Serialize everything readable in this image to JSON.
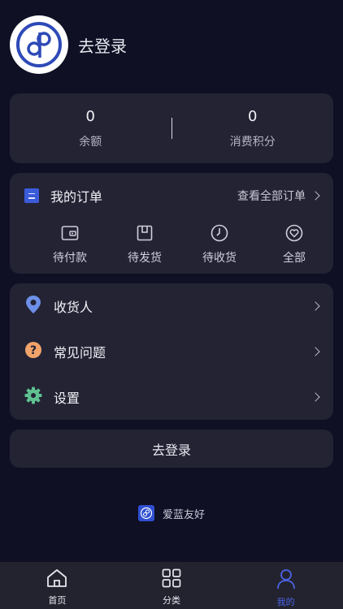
{
  "header": {
    "login_text": "去登录"
  },
  "stats": [
    {
      "value": "0",
      "label": "余额"
    },
    {
      "value": "0",
      "label": "消费积分"
    }
  ],
  "orders": {
    "title": "我的订单",
    "view_all": "查看全部订单",
    "items": [
      {
        "label": "待付款",
        "icon": "wallet-icon"
      },
      {
        "label": "待发货",
        "icon": "package-icon"
      },
      {
        "label": "待收货",
        "icon": "clock-icon"
      },
      {
        "label": "全部",
        "icon": "heart-icon"
      }
    ]
  },
  "menu": [
    {
      "label": "收货人",
      "icon": "location-pin-icon",
      "color": "#6d8fe8"
    },
    {
      "label": "常见问题",
      "icon": "question-icon",
      "color": "#f0a36a"
    },
    {
      "label": "设置",
      "icon": "gear-icon",
      "color": "#5fc190"
    }
  ],
  "login_button": "去登录",
  "brand": {
    "name": "爱蓝友好"
  },
  "tabbar": {
    "items": [
      {
        "label": "首页",
        "icon": "home-icon"
      },
      {
        "label": "分类",
        "icon": "category-grid-icon"
      },
      {
        "label": "我的",
        "icon": "user-icon",
        "active": true
      }
    ]
  },
  "colors": {
    "background": "#0f1024",
    "card": "#232334",
    "accent": "#4b63e6"
  }
}
